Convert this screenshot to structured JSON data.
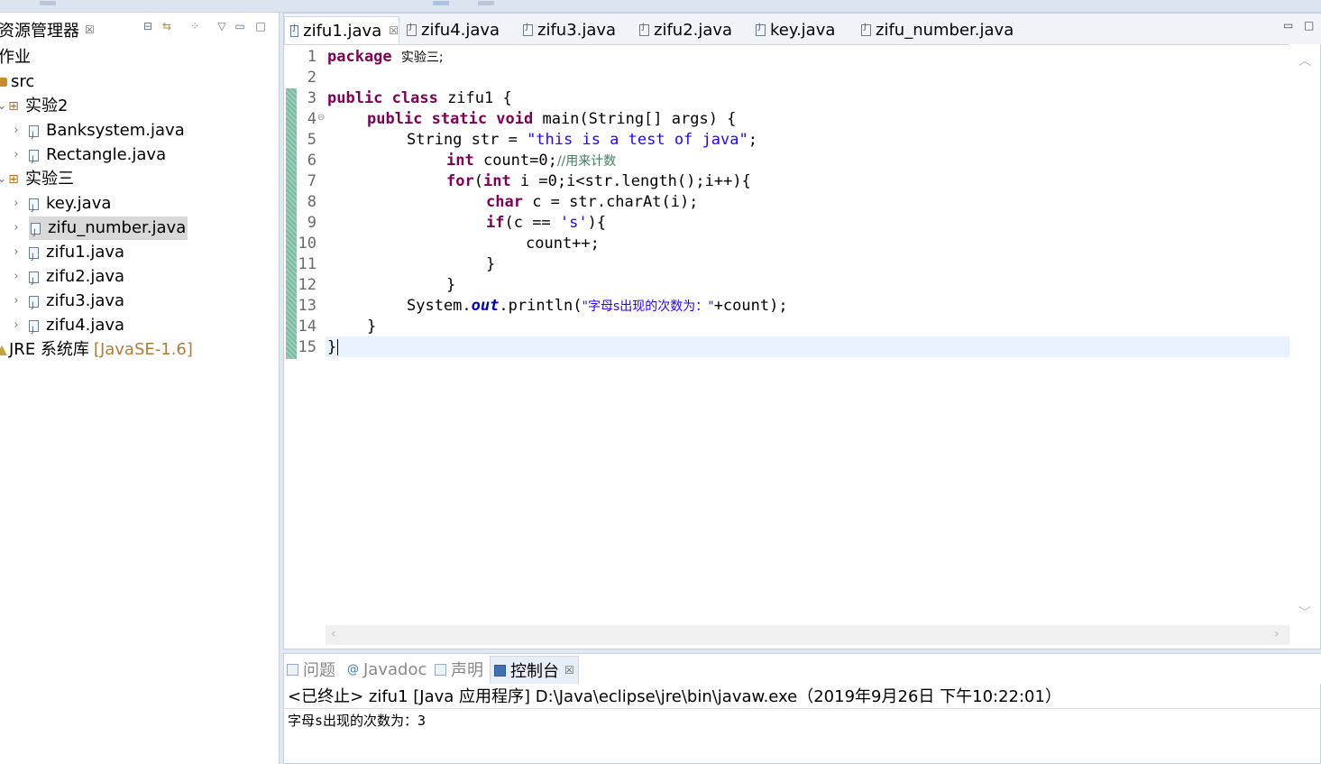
{
  "explorer": {
    "title": "资源管理器",
    "close_glyph": "☒",
    "tree": [
      {
        "label": "作业",
        "type": "project"
      },
      {
        "label": "src",
        "type": "src"
      },
      {
        "label": "实验2",
        "type": "package"
      },
      {
        "label": "Banksystem.java",
        "type": "file"
      },
      {
        "label": "Rectangle.java",
        "type": "file"
      },
      {
        "label": "实验三",
        "type": "package"
      },
      {
        "label": "key.java",
        "type": "file"
      },
      {
        "label": "zifu_number.java",
        "type": "file",
        "selected": true
      },
      {
        "label": "zifu1.java",
        "type": "file"
      },
      {
        "label": "zifu2.java",
        "type": "file"
      },
      {
        "label": "zifu3.java",
        "type": "file"
      },
      {
        "label": "zifu4.java",
        "type": "file"
      },
      {
        "label": "JRE 系统库",
        "type": "library",
        "version": "[JavaSE-1.6]"
      }
    ]
  },
  "editor": {
    "tabs": [
      "zifu1.java",
      "zifu4.java",
      "zifu3.java",
      "zifu2.java",
      "key.java",
      "zifu_number.java"
    ],
    "active_tab": "zifu1.java",
    "close_glyph": "☒",
    "line_numbers": [
      "1",
      "2",
      "3",
      "4",
      "5",
      "6",
      "7",
      "8",
      "9",
      "10",
      "11",
      "12",
      "13",
      "14",
      "15"
    ],
    "code": {
      "l1_kw": "package",
      "l1_rest": "实验三;",
      "l3_kw": "public class",
      "l3_rest": " zifu1 {",
      "l4_kw": "public static void",
      "l4_rest": " main(String[] args) {",
      "l5_a": "String str = ",
      "l5_str": "\"this is a test of java\"",
      "l5_b": ";",
      "l6_kw": "int",
      "l6_a": " count=0;",
      "l6_cm": "//用来计数",
      "l7_kw": "for",
      "l7_a": "(",
      "l7_kw2": "int",
      "l7_b": " i =0;i<str.length();i++){",
      "l8_kw": "char",
      "l8_a": " c = str.charAt(i);",
      "l9_kw": "if",
      "l9_a": "(c == ",
      "l9_str": "'s'",
      "l9_b": "){",
      "l10": "count++;",
      "l11": "}",
      "l12": "}",
      "l13_a": "System.",
      "l13_fld": "out",
      "l13_b": ".println(",
      "l13_str": "\"字母s出现的次数为：\"",
      "l13_c": "+count);",
      "l14": "}",
      "l15": "}"
    }
  },
  "console": {
    "tabs": [
      "问题",
      "Javadoc",
      "声明",
      "控制台"
    ],
    "active_tab": "控制台",
    "close_glyph": "☒",
    "status": "<已终止> zifu1 [Java 应用程序] D:\\Java\\eclipse\\jre\\bin\\javaw.exe（2019年9月26日 下午10:22:01）",
    "output": "字母s出现的次数为：3"
  }
}
